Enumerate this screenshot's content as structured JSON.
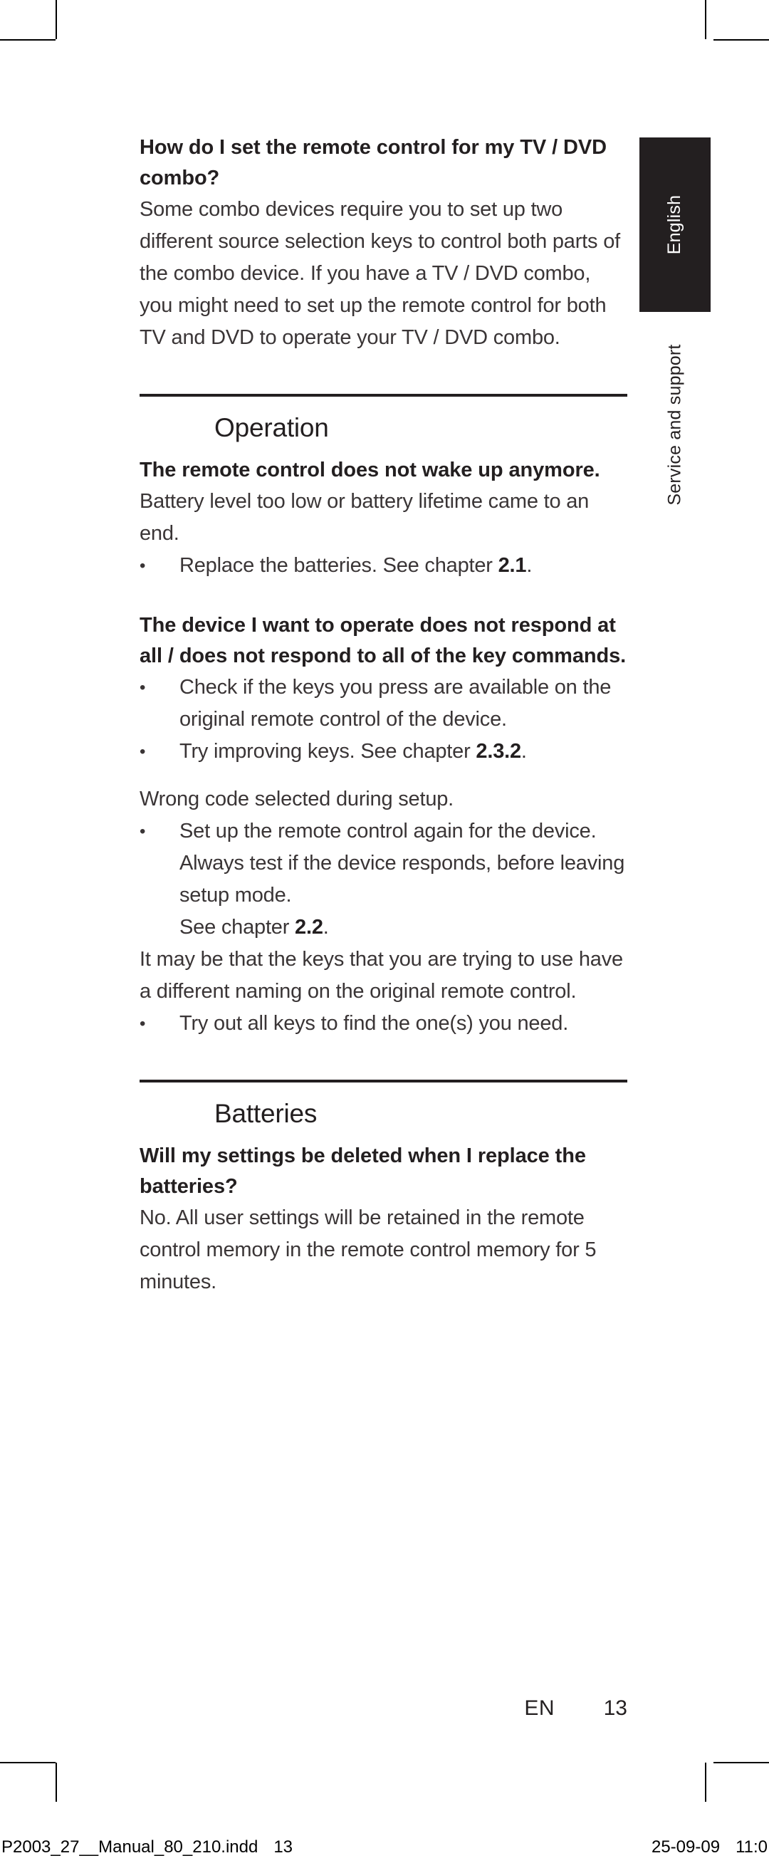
{
  "document": {
    "language_tab": "English",
    "chapter_tab": "Service and support",
    "footer": {
      "lang_code": "EN",
      "page_number": "13"
    },
    "print_slug": {
      "filename": "P2003_27__Manual_80_210.indd",
      "page": "13",
      "date": "25-09-09",
      "time": "11:0"
    }
  },
  "faq_top": {
    "question": "How do I set the remote control for my TV / DVD combo?",
    "answer": "Some combo devices require you to set up two different source selection keys to control both parts of the combo device. If you have a TV / DVD combo, you might need to set up the remote control for both  TV and DVD to operate your TV / DVD combo."
  },
  "sections": [
    {
      "heading": "Operation",
      "blocks": [
        {
          "question": "The remote control does not wake up anymore.",
          "answer": "Battery level too low or battery lifetime came to an end.",
          "bullets": [
            {
              "text_before": "Replace the batteries. See chapter ",
              "ref": "2.1",
              "text_after": "."
            }
          ]
        },
        {
          "question": "The device I want to operate does not respond at all / does not respond to all of the key commands.",
          "answer": "",
          "bullets": [
            {
              "text_before": "Check if the keys you press are available on the original remote control of the device.",
              "ref": "",
              "text_after": ""
            },
            {
              "text_before": "Try improving keys. See chapter ",
              "ref": "2.3.2",
              "text_after": "."
            }
          ]
        },
        {
          "question": "",
          "answer": "Wrong code selected during setup.",
          "bullets": [
            {
              "text_before": "Set up the remote control again for the device. Always test if the device responds, before leaving setup mode.",
              "ref": "",
              "text_after": "",
              "extra_line_before": "See chapter ",
              "extra_ref": "2.2",
              "extra_line_after": "."
            }
          ]
        },
        {
          "question": "",
          "answer": "It may be that the keys that you are trying to use have a different naming on the original remote control.",
          "bullets": [
            {
              "text_before": "Try out all keys to find the one(s) you need.",
              "ref": "",
              "text_after": ""
            }
          ]
        }
      ]
    },
    {
      "heading": "Batteries",
      "blocks": [
        {
          "question": "Will my settings be deleted when I replace the batteries?",
          "answer": "No. All user settings will be retained in the remote control memory in the remote control memory for 5 minutes.",
          "bullets": []
        }
      ]
    }
  ]
}
